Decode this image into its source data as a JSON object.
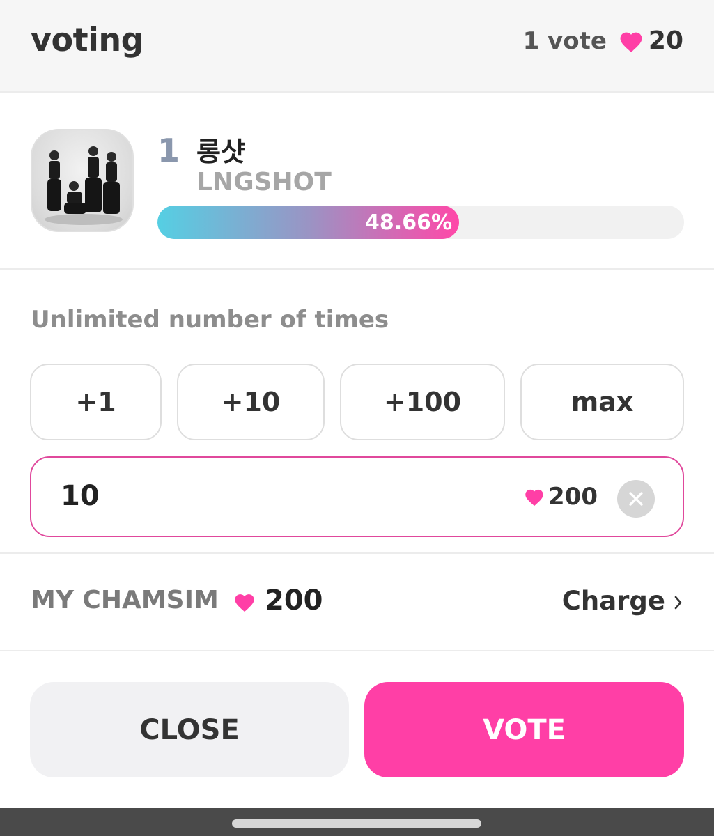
{
  "header": {
    "title": "voting",
    "vote_count": "1 vote",
    "heart_total": "20"
  },
  "candidate": {
    "rank": "1",
    "name_ko": "롱샷",
    "name_en": "LNGSHOT",
    "percent_label": "48.66%",
    "percent_value": 0.4866
  },
  "quantity": {
    "caption": "Unlimited number of times",
    "buttons": [
      "+1",
      "+10",
      "+100",
      "max"
    ],
    "input_value": "10",
    "cost": "200"
  },
  "my_chamsim": {
    "label": "MY CHAMSIM",
    "value": "200",
    "charge_label": "Charge"
  },
  "actions": {
    "close_label": "CLOSE",
    "vote_label": "VOTE"
  },
  "colors": {
    "accent": "#ff3fa6",
    "heart": "#ff3fa6",
    "input_border": "#e0489c",
    "progress_start": "#55cfe3",
    "progress_end": "#ff48a8",
    "rank": "#8a97ad"
  },
  "icons": {
    "heart": "heart-icon",
    "clear": "close-circle-icon",
    "charge": "chevron-right-icon"
  }
}
